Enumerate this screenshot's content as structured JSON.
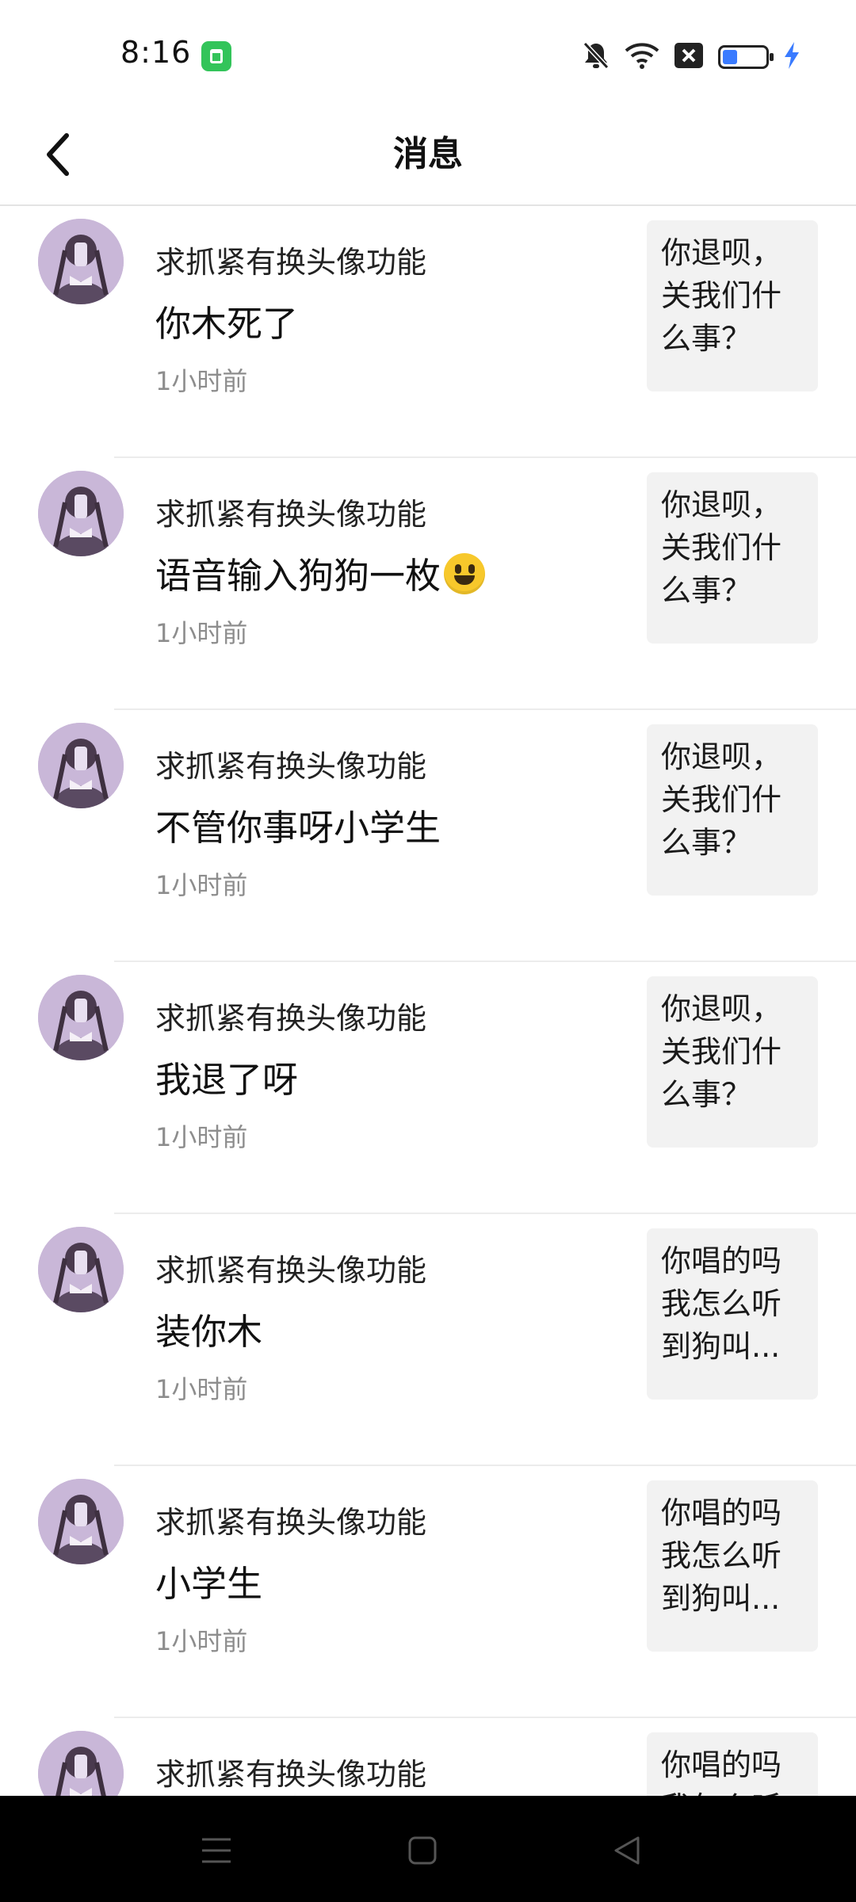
{
  "status_bar": {
    "time": "8:16",
    "icons": [
      "app-notification-icon",
      "bell-muted-icon",
      "wifi-icon",
      "x-box-icon",
      "battery-icon",
      "charging-bolt-icon"
    ],
    "battery_color": "#3a7bff",
    "charging_color": "#3a7bff"
  },
  "header": {
    "title": "消息",
    "back_icon": "chevron-left-icon"
  },
  "messages": [
    {
      "username": "求抓紧有换头像功能",
      "content": "你木死了",
      "time": "1小时前",
      "preview": "你退呗，关我们什么事？"
    },
    {
      "username": "求抓紧有换头像功能",
      "content": "语音输入狗狗一枚",
      "emoji": "smiley-emoji",
      "time": "1小时前",
      "preview": "你退呗，关我们什么事？"
    },
    {
      "username": "求抓紧有换头像功能",
      "content": "不管你事呀小学生",
      "time": "1小时前",
      "preview": "你退呗，关我们什么事？"
    },
    {
      "username": "求抓紧有换头像功能",
      "content": "我退了呀",
      "time": "1小时前",
      "preview": "你退呗，关我们什么事？"
    },
    {
      "username": "求抓紧有换头像功能",
      "content": "装你木",
      "time": "1小时前",
      "preview": "你唱的吗我怎么听到狗叫..."
    },
    {
      "username": "求抓紧有换头像功能",
      "content": "小学生",
      "time": "1小时前",
      "preview": "你唱的吗我怎么听到狗叫..."
    },
    {
      "username": "求抓紧有换头像功能",
      "content": "",
      "time": "",
      "preview": "你唱的吗我怎么听到狗叫..."
    }
  ],
  "nav_bar": {
    "icons": [
      "menu-icon",
      "home-square-icon",
      "back-triangle-icon"
    ]
  }
}
